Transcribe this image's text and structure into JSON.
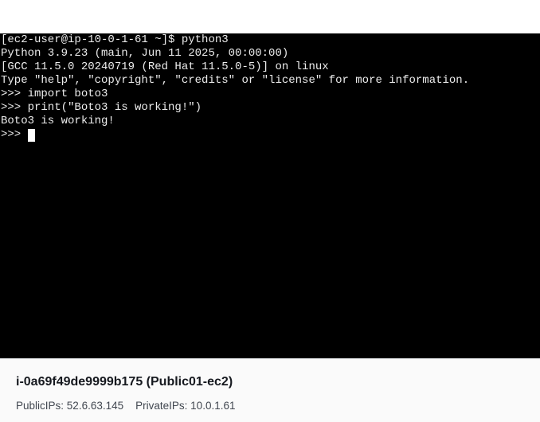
{
  "terminal": {
    "lines": [
      "[ec2-user@ip-10-0-1-61 ~]$ python3",
      "Python 3.9.23 (main, Jun 11 2025, 00:00:00)",
      "[GCC 11.5.0 20240719 (Red Hat 11.5.0-5)] on linux",
      "Type \"help\", \"copyright\", \"credits\" or \"license\" for more information.",
      ">>> import boto3",
      ">>> print(\"Boto3 is working!\")",
      "Boto3 is working!"
    ],
    "prompt": ">>> "
  },
  "instance": {
    "title": "i-0a69f49de9999b175 (Public01-ec2)",
    "public_ips_label": "PublicIPs:",
    "public_ips_value": "52.6.63.145",
    "private_ips_label": "PrivateIPs:",
    "private_ips_value": "10.0.1.61"
  }
}
